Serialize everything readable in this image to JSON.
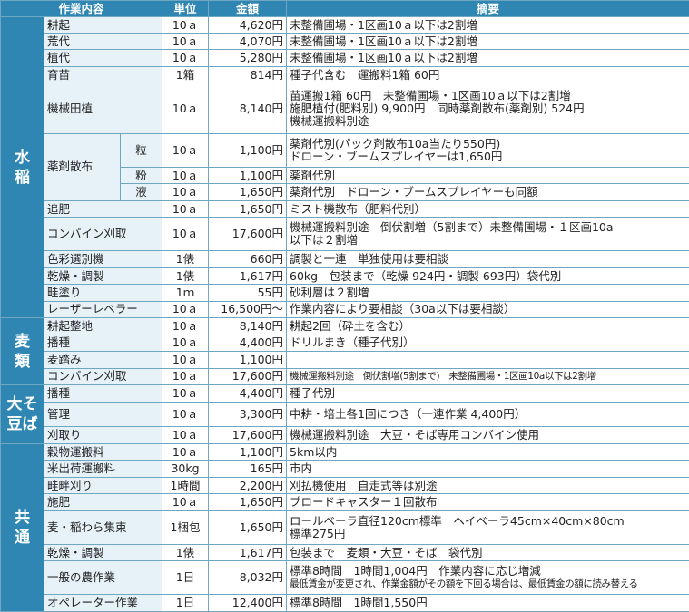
{
  "headers": {
    "work": "作業内容",
    "unit": "単位",
    "amount": "金額",
    "memo": "摘要"
  },
  "categories": {
    "rice": [
      "水",
      "稲"
    ],
    "wheat": [
      "麦",
      "類"
    ],
    "soy": [
      "大そ",
      "豆ば"
    ],
    "common": [
      "共",
      "通"
    ]
  },
  "rows": [
    {
      "name": "耕起",
      "unit": "10ａ",
      "amount": "4,620円",
      "memo": [
        "未整備圃場・1区画10ａ以下は2割増"
      ]
    },
    {
      "name": "荒代",
      "unit": "10ａ",
      "amount": "4,070円",
      "memo": [
        "未整備圃場・1区画10ａ以下は2割増"
      ]
    },
    {
      "name": "植代",
      "unit": "10ａ",
      "amount": "5,280円",
      "memo": [
        "未整備圃場・1区画10ａ以下は2割増"
      ]
    },
    {
      "name": "育苗",
      "unit": "1箱",
      "amount": "814円",
      "memo": [
        "種子代含む　運搬料1箱 60円"
      ]
    },
    {
      "name": "機械田植",
      "unit": "10ａ",
      "amount": "8,140円",
      "memo": [
        "苗運搬1箱 60円　未整備圃場・1区画10ａ以下は2割増",
        "施肥植付(肥料別) 9,900円　同時薬剤散布(薬剤別) 524円",
        "機械運搬料別途"
      ]
    },
    {
      "name": "薬剤散布",
      "sub": "粒",
      "unit": "10ａ",
      "amount": "1,100円",
      "memo": [
        "薬剤代別(パック剤散布10a当たり550円)",
        "ドローン・ブームスプレイヤーは1,650円"
      ]
    },
    {
      "sub": "粉",
      "unit": "10ａ",
      "amount": "1,100円",
      "memo": [
        "薬剤代別"
      ]
    },
    {
      "sub": "液",
      "unit": "10ａ",
      "amount": "1,650円",
      "memo": [
        "薬剤代別　ドローン・ブームスプレイヤーも同額"
      ]
    },
    {
      "name": "追肥",
      "unit": "10ａ",
      "amount": "1,650円",
      "memo": [
        "ミスト機散布（肥料代別）"
      ]
    },
    {
      "name": "コンバイン刈取",
      "unit": "10ａ",
      "amount": "17,600円",
      "memo": [
        "機械運搬料別途　倒伏割増（5割まで）未整備圃場・１区画10a",
        "以下は２割増"
      ]
    },
    {
      "name": "色彩選別機",
      "unit": "1俵",
      "amount": "660円",
      "memo": [
        "調製と一連　単独使用は要相談"
      ]
    },
    {
      "name": "乾燥・調製",
      "unit": "1俵",
      "amount": "1,617円",
      "memo": [
        "60kg　包装まで（乾燥 924円・調製 693円）袋代別"
      ]
    },
    {
      "name": "畦塗り",
      "unit": "1ｍ",
      "amount": "55円",
      "memo": [
        "砂利層は２割増"
      ]
    },
    {
      "name": "レーザーレベラー",
      "unit": "10ａ",
      "amount": "16,500円～",
      "memo": [
        "作業内容により要相談（30a以下は要相談）"
      ]
    },
    {
      "name": "耕起整地",
      "unit": "10ａ",
      "amount": "8,140円",
      "memo": [
        "耕起2回（砕土を含む）"
      ]
    },
    {
      "name": "播種",
      "unit": "10ａ",
      "amount": "4,400円",
      "memo": [
        "ドリルまき（種子代別）"
      ]
    },
    {
      "name": "麦踏み",
      "unit": "10ａ",
      "amount": "1,100円",
      "memo": [
        ""
      ]
    },
    {
      "name": "コンバイン刈取",
      "unit": "10ａ",
      "amount": "17,600円",
      "memo": [
        "機械運搬料別途　倒伏割増(5割まで)　未整備圃場・1区画10a以下は2割増"
      ]
    },
    {
      "name": "播種",
      "unit": "10ａ",
      "amount": "4,400円",
      "memo": [
        "種子代別"
      ]
    },
    {
      "name": "管理",
      "unit": "10ａ",
      "amount": "3,300円",
      "memo": [
        "中耕・培土各1回につき（一連作業 4,400円）"
      ]
    },
    {
      "name": "刈取り",
      "unit": "10ａ",
      "amount": "17,600円",
      "memo": [
        "機械運搬料別途　大豆・そば専用コンバイン使用"
      ]
    },
    {
      "name": "穀物運搬料",
      "unit": "10ａ",
      "amount": "1,100円",
      "memo": [
        "5km以内"
      ]
    },
    {
      "name": "米出荷運搬料",
      "unit": "30kg",
      "amount": "165円",
      "memo": [
        "市内"
      ]
    },
    {
      "name": "畦畔刈り",
      "unit": "1時間",
      "amount": "2,200円",
      "memo": [
        "刈払機使用　自走式等は別途"
      ]
    },
    {
      "name": "施肥",
      "unit": "10ａ",
      "amount": "1,650円",
      "memo": [
        "ブロードキャスター１回散布"
      ]
    },
    {
      "name": "麦・稲わら集束",
      "unit": "1梱包",
      "amount": "1,650円",
      "memo": [
        "ロールベーラ直径120cm標準　ヘイベーラ45cm×40cm×80cm",
        "標準275円"
      ]
    },
    {
      "name": "乾燥・調製",
      "unit": "1俵",
      "amount": "1,617円",
      "memo": [
        "包装まで　麦類・大豆・そば　袋代別"
      ]
    },
    {
      "name": "一般の農作業",
      "unit": "1日",
      "amount": "8,032円",
      "memo": [
        "標準8時間　1時間1,004円　作業内容に応じ増減",
        "最低賃金が変更され、作業金額がその額を下回る場合は、最低賃金の額に読み替える"
      ]
    },
    {
      "name": "オペレーター作業",
      "unit": "1日",
      "amount": "12,400円",
      "memo": [
        "標準8時間　1時間1,550円"
      ]
    }
  ]
}
